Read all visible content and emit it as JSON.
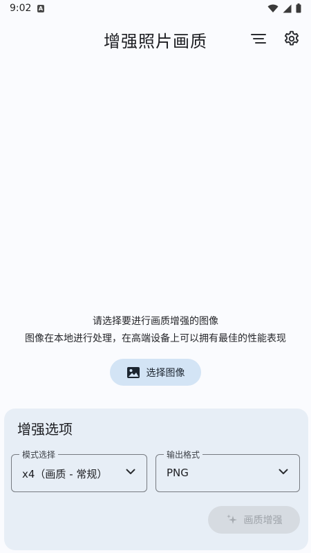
{
  "status_bar": {
    "time": "9:02",
    "notification_badge": "A"
  },
  "app_bar": {
    "title": "增强照片画质",
    "menu_icon": "sort-lines-icon",
    "settings_icon": "gear-icon"
  },
  "empty_state": {
    "line1": "请选择要进行画质增强的图像",
    "line2": "图像在本地进行处理，在高端设备上可以拥有最佳的性能表现",
    "select_button": "选择图像"
  },
  "options": {
    "title": "增强选项",
    "mode_label": "模式选择",
    "mode_value": "x4（画质 - 常规）",
    "format_label": "输出格式",
    "format_value": "PNG",
    "enhance_button": "画质增强"
  },
  "colors": {
    "background": "#fafbfe",
    "panel": "#e7eef6",
    "select_button_bg": "#d3e4f5",
    "disabled_button_bg": "#d6dbe1"
  }
}
